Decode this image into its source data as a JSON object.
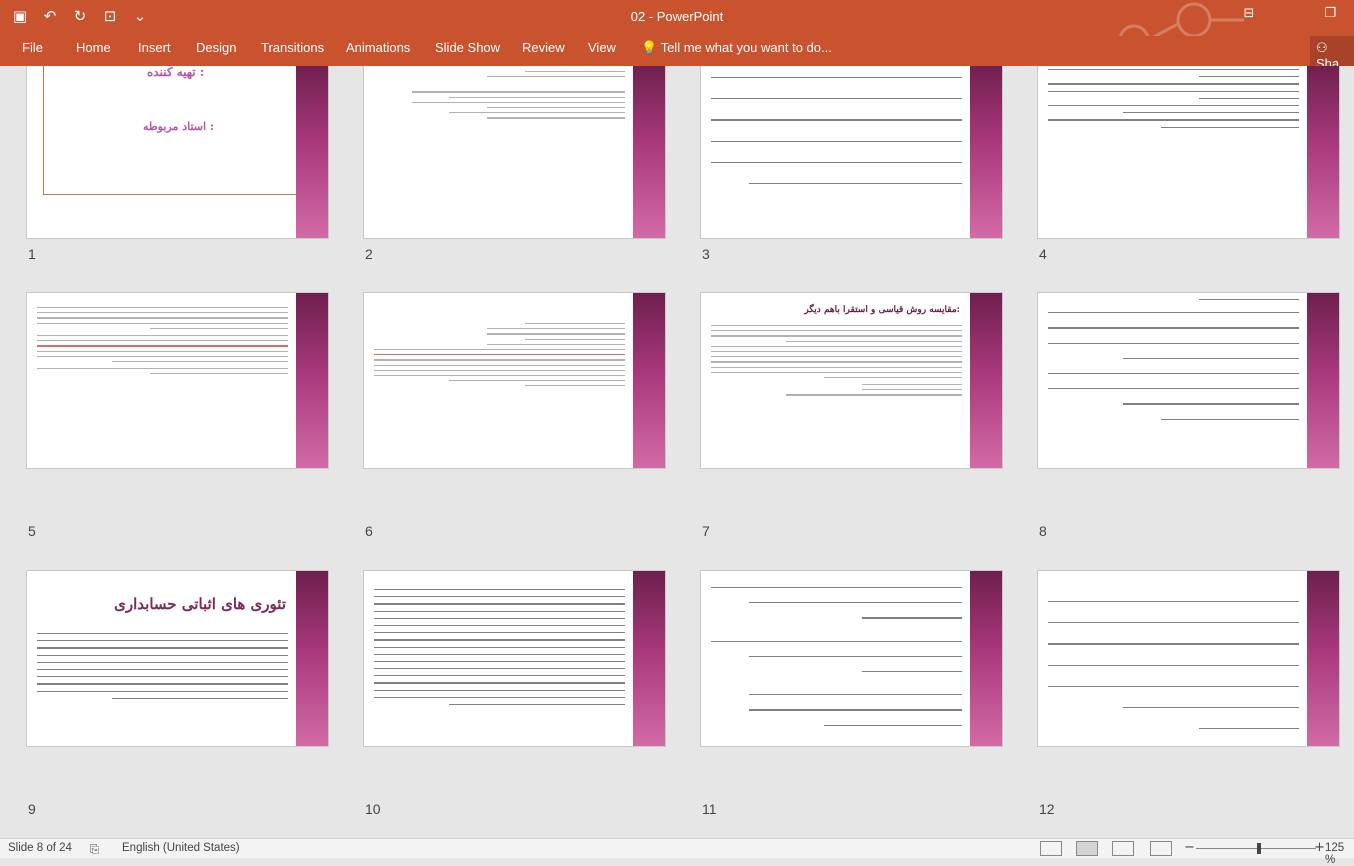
{
  "app": {
    "window_title": "02 - PowerPoint",
    "quick_access": [
      {
        "icon": "save-icon"
      },
      {
        "icon": "undo-icon"
      },
      {
        "icon": "redo-icon"
      },
      {
        "icon": "present-icon"
      },
      {
        "icon": "customize-icon"
      }
    ]
  },
  "ribbon": {
    "tabs": [
      "File",
      "Home",
      "Insert",
      "Design",
      "Transitions",
      "Animations",
      "Slide Show",
      "Review",
      "View"
    ],
    "tell_me": "Tell me what you want to do...",
    "share": "Sha"
  },
  "slides": [
    {
      "number": "1",
      "title_lines": [
        "تهیه کننده :",
        "استاد مربوطه :"
      ]
    },
    {
      "number": "2"
    },
    {
      "number": "3"
    },
    {
      "number": "4"
    },
    {
      "number": "5"
    },
    {
      "number": "6"
    },
    {
      "number": "7",
      "title": "مقایسه روش قیاسی و استقرا باهم دیگر:"
    },
    {
      "number": "8"
    },
    {
      "number": "9",
      "title": "تئوری های اثباتی حسابداری"
    },
    {
      "number": "10"
    },
    {
      "number": "11"
    },
    {
      "number": "12"
    }
  ],
  "status": {
    "slide_info": "Slide 8 of 24",
    "language": "English (United States)",
    "zoom": "125 %",
    "zoom_level_percent": 125
  },
  "colors": {
    "ribbon": "#c9532f",
    "slide_bar_dark": "#6e1f4e",
    "slide_bar_light": "#d26aa6"
  }
}
